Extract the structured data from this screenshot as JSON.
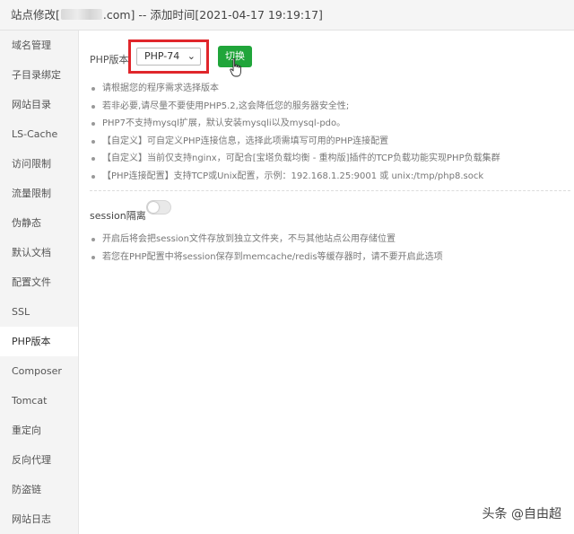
{
  "window": {
    "title_prefix": "站点修改[",
    "title_suffix": ".com] -- 添加时间[2021-04-17 19:19:17]"
  },
  "sidebar": {
    "items": [
      {
        "label": "域名管理"
      },
      {
        "label": "子目录绑定"
      },
      {
        "label": "网站目录"
      },
      {
        "label": "LS-Cache"
      },
      {
        "label": "访问限制"
      },
      {
        "label": "流量限制"
      },
      {
        "label": "伪静态"
      },
      {
        "label": "默认文档"
      },
      {
        "label": "配置文件"
      },
      {
        "label": "SSL"
      },
      {
        "label": "PHP版本",
        "active": true
      },
      {
        "label": "Composer"
      },
      {
        "label": "Tomcat"
      },
      {
        "label": "重定向"
      },
      {
        "label": "反向代理"
      },
      {
        "label": "防盗链"
      },
      {
        "label": "网站日志"
      }
    ]
  },
  "php": {
    "label": "PHP版本",
    "selected_version": "PHP-74",
    "switch_button": "切换",
    "highlight_color": "#e0262b",
    "button_color": "#20a53a"
  },
  "tips": [
    "请根据您的程序需求选择版本",
    "若非必要,请尽量不要使用PHP5.2,这会降低您的服务器安全性;",
    "PHP7不支持mysql扩展，默认安装mysqli以及mysql-pdo。",
    "【自定义】可自定义PHP连接信息，选择此项需填写可用的PHP连接配置",
    "【自定义】当前仅支持nginx，可配合[宝塔负载均衡 - 重构版]插件的TCP负载功能实现PHP负载集群",
    "【PHP连接配置】支持TCP或Unix配置，示例：192.168.1.25:9001 或 unix:/tmp/php8.sock"
  ],
  "session": {
    "label": "session隔离",
    "enabled": false,
    "tips": [
      "开启后将会把session文件存放到独立文件夹，不与其他站点公用存储位置",
      "若您在PHP配置中将session保存到memcache/redis等缓存器时，请不要开启此选项"
    ]
  },
  "watermark": "头条 @自由超"
}
